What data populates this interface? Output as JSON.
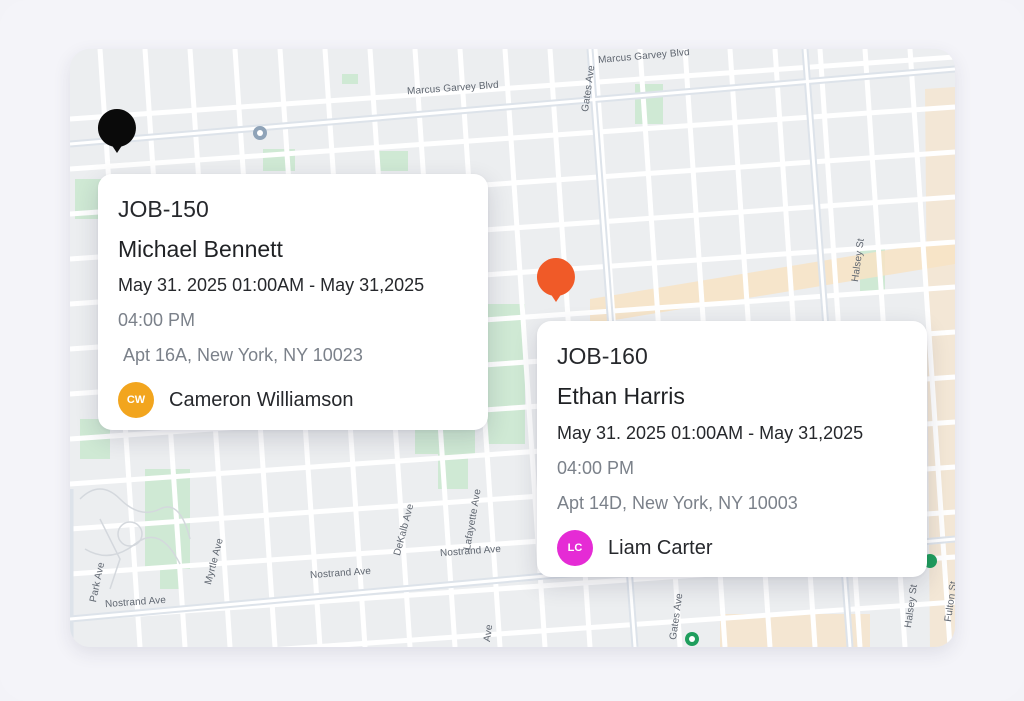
{
  "colors": {
    "pin_black": "#0a0a0a",
    "pin_orange": "#f05a28",
    "avatar_cw": "#f2a51e",
    "avatar_lc": "#e52bd5",
    "park": "#cfe9d4",
    "street": "#ffffff",
    "highlight_road": "#f8e3c4"
  },
  "map": {
    "street_labels": {
      "marcus_garvey_1": "Marcus Garvey Blvd",
      "marcus_garvey_2": "Marcus Garvey Blvd",
      "gates_ave_top": "Gates Ave",
      "halsey_top": "Halsey St",
      "myrtle": "Myrtle Ave",
      "park_ave": "Park Ave",
      "nostrand_left": "Nostrand Ave",
      "nostrand_mid": "Nostrand Ave",
      "nostrand_right": "Nostrand Ave",
      "dekalb": "DeKalb Ave",
      "lafayette": "Lafayette Ave",
      "gates_ave_bottom": "Gates Ave",
      "halsey_bottom": "Halsey St",
      "fulton": "Fulton St",
      "ave_bottom": "Ave"
    },
    "pins": [
      {
        "id": "pin-job-150",
        "color": "black"
      },
      {
        "id": "pin-job-160",
        "color": "orange"
      }
    ]
  },
  "cards": [
    {
      "job_id": "JOB-150",
      "customer": "Michael Bennett",
      "time_range": "May 31. 2025 01:00AM - May 31,2025",
      "time_end": "04:00 PM",
      "address": "Apt 16A, New York, NY 10023",
      "assignee_initials": "CW",
      "assignee_name": "Cameron Williamson"
    },
    {
      "job_id": "JOB-160",
      "customer": "Ethan Harris",
      "time_range": "May 31. 2025 01:00AM - May 31,2025",
      "time_end": "04:00 PM",
      "address": "Apt 14D, New York, NY 10003",
      "assignee_initials": "LC",
      "assignee_name": "Liam Carter"
    }
  ]
}
